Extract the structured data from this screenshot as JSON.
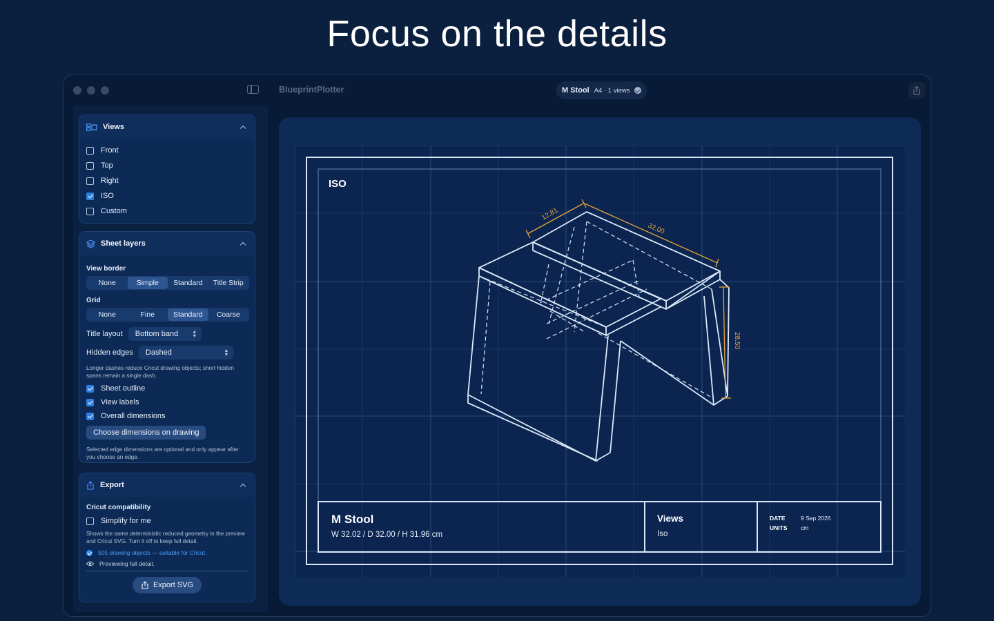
{
  "headline": "Focus on the details",
  "window": {
    "app_name": "BlueprintPlotter",
    "document": {
      "name": "M Stool",
      "meta": "A4 · 1 views"
    }
  },
  "views_panel": {
    "title": "Views",
    "items": [
      {
        "label": "Front",
        "checked": false
      },
      {
        "label": "Top",
        "checked": false
      },
      {
        "label": "Right",
        "checked": false
      },
      {
        "label": "ISO",
        "checked": true
      },
      {
        "label": "Custom",
        "checked": false
      }
    ]
  },
  "sheet_layers": {
    "title": "Sheet layers",
    "view_border_label": "View border",
    "view_border_options": [
      "None",
      "Simple",
      "Standard",
      "Title Strip"
    ],
    "view_border_selected": "Simple",
    "grid_label": "Grid",
    "grid_options": [
      "None",
      "Fine",
      "Standard",
      "Coarse"
    ],
    "grid_selected": "Standard",
    "title_layout_label": "Title layout",
    "title_layout_value": "Bottom band",
    "hidden_edges_label": "Hidden edges",
    "hidden_edges_value": "Dashed",
    "hidden_edges_help": "Longer dashes reduce Cricut drawing objects; short hidden spans remain a single dash.",
    "toggles": [
      {
        "label": "Sheet outline",
        "checked": true
      },
      {
        "label": "View labels",
        "checked": true
      },
      {
        "label": "Overall dimensions",
        "checked": true
      }
    ],
    "choose_dimensions_button": "Choose dimensions on drawing",
    "dimensions_help": "Selected edge dimensions are optional and only appear after you choose an edge."
  },
  "export_panel": {
    "title": "Export",
    "cricut_label": "Cricut compatibility",
    "simplify_label": "Simplify for me",
    "simplify_checked": false,
    "simplify_help": "Shows the same deterministic reduced geometry in the preview and Cricut SVG. Turn it off to keep full detail.",
    "status_ok": "505 drawing objects — suitable for Cricut.",
    "preview_status": "Previewing full detail.",
    "export_button": "Export SVG"
  },
  "drawing": {
    "view_label": "ISO",
    "dimensions": {
      "depth": "12.81",
      "width": "32.00",
      "height": "28.50"
    },
    "title_block": {
      "name": "M Stool",
      "size": "W 32.02 / D 32.00 / H 31.96 cm",
      "views_label": "Views",
      "views_value": "Iso",
      "date_label": "DATE",
      "date_value": "9 Sep 2026",
      "units_label": "UNITS",
      "units_value": "cm"
    }
  },
  "colors": {
    "background": "#0b1f3e",
    "sheet": "#0b2550",
    "line": "#dbe8f8",
    "dimension": "#e8a33a",
    "accent": "#2f7fe0"
  }
}
